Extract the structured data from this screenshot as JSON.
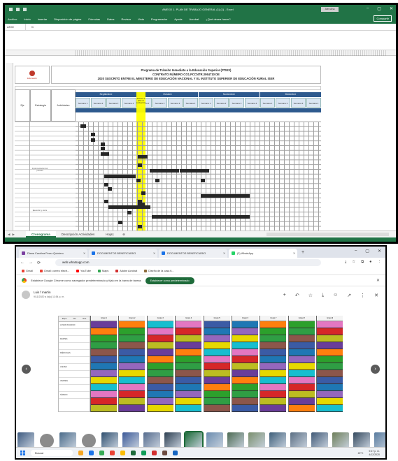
{
  "excel": {
    "window_title": "ANEXO 1. PLAN DE TRABAJO GENERAL (1) (1)  -  Excel",
    "user_badge": "Alex Ana",
    "window_controls": [
      "–",
      "▢",
      "✕"
    ],
    "ribbon_tabs": [
      "Archivo",
      "Inicio",
      "Insertar",
      "Disposición de página",
      "Fórmulas",
      "Datos",
      "Revisar",
      "Vista",
      "Programador",
      "Ayuda",
      "Acrobat",
      "¿Qué desea hacer?"
    ],
    "share_label": "Compartir",
    "name_box": "AK50",
    "fx_label": "fx",
    "logo_text": "Educación",
    "sheet_titles": [
      "Programa de Tránsito Inmediato a la Educación Superior (PTIES)",
      "CONTRATO NÚMERO CO1.PCCNTR.3064710 DE",
      "2020 SUSCRITO ENTRE EL MINISTERIO DE EDUCACIÓN NACIONAL Y EL INSTITUTO SUPERIOR DE EDUCACIÓN RURAL ISER"
    ],
    "left_headers": [
      "Eje",
      "Estrategia",
      "Actividades"
    ],
    "months": [
      "Septiembre",
      "Octubre",
      "Noviembre",
      "Diciembre"
    ],
    "week_label": "Semana",
    "highlight_label": "Semana 1 (Mes en evaluación)",
    "group_labels": [
      "Implementación del proceso",
      "Ejecución y cierre"
    ],
    "sheet_tabs": [
      "Cronograma",
      "Descripción Actividades",
      "Hoja1"
    ],
    "active_sheet": "Cronograma",
    "add_sheet": "⊕"
  },
  "browser": {
    "tabs": [
      {
        "label": "Diana Carolina Perez Quintero",
        "color": "#7b3fa0"
      },
      {
        "label": "DOCUMENTOS BENEFICIARIO",
        "color": "#1a73e8"
      },
      {
        "label": "DOCUMENTOS BENEFICIARIO",
        "color": "#1a73e8"
      },
      {
        "label": "(3) WhatsApp",
        "color": "#25d366"
      }
    ],
    "new_tab": "+",
    "window_controls": [
      "–",
      "▢",
      "✕"
    ],
    "nav_icons": [
      "←",
      "→",
      "⟳"
    ],
    "url": "web.whatsapp.com",
    "bookmarks": [
      {
        "label": "Gmail",
        "color": "#ea4335"
      },
      {
        "label": "Gmail: correo electr...",
        "color": "#ea4335"
      },
      {
        "label": "YouTube",
        "color": "#ff0000"
      },
      {
        "label": "Maps",
        "color": "#34a853"
      },
      {
        "label": "Adobe Acrobat",
        "color": "#d32f2f"
      },
      {
        "label": "Diseño de la casa ti...",
        "color": "#8e6b3a"
      }
    ],
    "banner_text": "Establece Google Chrome como navegador predeterminado y fíjalo en la barra de tareas",
    "banner_button": "Establecer como predeterminado",
    "banner_close": "✕"
  },
  "whatsapp": {
    "sender": "Luis f martin",
    "date": "9/11/2020 a la(s) 11:54 p. m.",
    "header_icons": [
      "+",
      "↶",
      "☆",
      "⤓",
      "☺",
      "↗",
      "⋮",
      "✕"
    ],
    "prev": "‹",
    "next": "›"
  },
  "photo_table": {
    "left_header": [
      "Etapa",
      "Día",
      "Hora"
    ],
    "left_rows": [
      "LUNES 09/11/2020",
      "",
      "MARTES",
      "",
      "MIÉRCOLES",
      "",
      "JUEVES",
      "",
      "VIERNES",
      "",
      "SÁBADO"
    ],
    "column_headers": [
      "Grupo 1",
      "Grupo 2",
      "Grupo 3",
      "Grupo 4",
      "Grupo 5",
      "Grupo 6",
      "Grupo 7",
      "Grupo 8",
      "Grupo 9"
    ],
    "colors": [
      "#6a3d9a",
      "#e6d800",
      "#2f9e44",
      "#d62728",
      "#1f77b4",
      "#ff7f0e",
      "#17becf",
      "#8c564b",
      "#bcbd22",
      "#9467bd",
      "#2ca02c",
      "#e377c2",
      "#3b5ba5"
    ]
  },
  "taskbar": {
    "search": "Buscar",
    "apps": [
      "#f5a623",
      "#1a73e8",
      "#34a853",
      "#ea4335",
      "#fbbc04",
      "#1e6b3a",
      "#0f9d58",
      "#d32f2f",
      "#6d4c41",
      "#1565c0"
    ],
    "weather": "22°C",
    "time": "9:47 p. m.",
    "date": "4/12/2020"
  }
}
